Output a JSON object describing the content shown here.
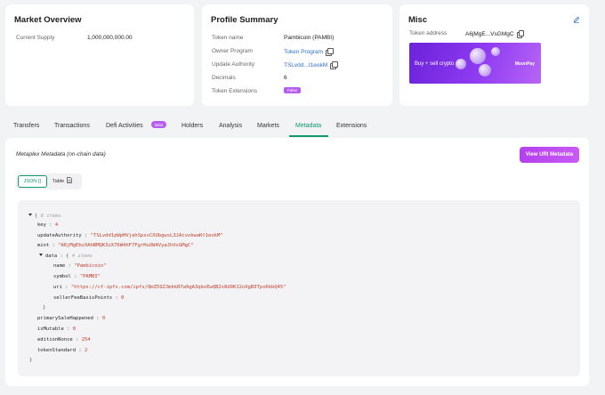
{
  "market": {
    "title": "Market Overview",
    "supply_label": "Current Supply",
    "supply_value": "1,000,000,000.00"
  },
  "profile": {
    "title": "Profile Summary",
    "rows": [
      {
        "label": "Token name",
        "value": "Pambicoin (PAMBI)"
      },
      {
        "label": "Owner Program",
        "value": "Token Program"
      },
      {
        "label": "Update Authority",
        "value": "TSLvdd...t1eokM"
      },
      {
        "label": "Decimals",
        "value": "6"
      },
      {
        "label": "Token Extensions",
        "value": "False"
      }
    ]
  },
  "misc": {
    "title": "Misc",
    "address_label": "Token address",
    "address_value": "A6jMgE...VsGMgC",
    "banner_text": "Buy + sell crypto",
    "banner_brand": "MoonPay"
  },
  "tabs": [
    {
      "label": "Transfers"
    },
    {
      "label": "Transactions"
    },
    {
      "label": "Defi Activities",
      "badge": "Beta"
    },
    {
      "label": "Holders"
    },
    {
      "label": "Analysis"
    },
    {
      "label": "Markets"
    },
    {
      "label": "Metadata",
      "active": true
    },
    {
      "label": "Extensions"
    }
  ],
  "metadata": {
    "section_title": "Metaplex Metadata (on-chain data)",
    "view_uri_button": "View URI Metadata",
    "view_json": "JSON {}",
    "view_table": "Table",
    "json": {
      "root_count": "8 items",
      "key": "4",
      "updateAuthority": "\"TSLvdd1pWpHVjahSpsvCXUbgwsL3JAcvokwaKt1eokM\"",
      "mint": "\"A6jMgEbvXAhBMQK3zX76W4hF7FgrHuXW4VyaJhVsGMgC\"",
      "data_count": "4 items",
      "name": "\"Pambicoin\"",
      "symbol": "\"PAMBI\"",
      "uri": "\"https://cf-ipfs.com/ipfs/QmZ59ZJmkkR7w9gA3qkoEwQB2s8d9KJ2oXgB3TpsKkbQ45\"",
      "sellerFeeBasisPoints": "0",
      "primarySaleHappened": "0",
      "isMutable": "0",
      "editionNonce": "254",
      "tokenStandard": "2"
    }
  },
  "colors": {
    "accent_green": "#0f9a6c",
    "accent_purple": "#b65cf0",
    "link_blue": "#2f6fd6",
    "string_red": "#c23e28"
  }
}
